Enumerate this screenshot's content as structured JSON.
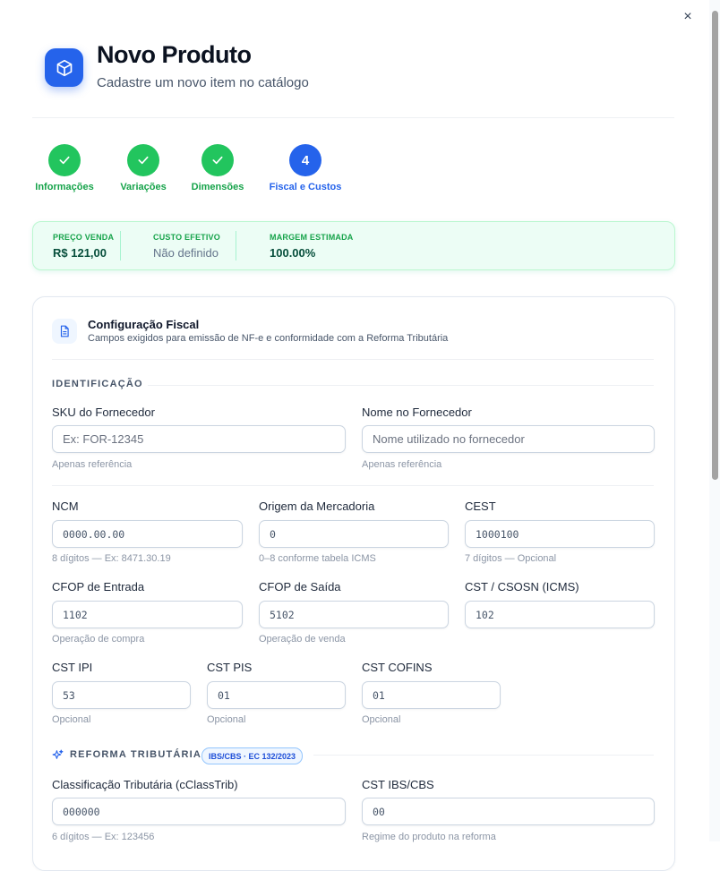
{
  "close_label": "×",
  "header": {
    "icon": "package-icon",
    "title": "Novo Produto",
    "subtitle": "Cadastre um novo item no catálogo"
  },
  "steps": [
    {
      "label": "Informações",
      "status": "done"
    },
    {
      "label": "Variações",
      "status": "done"
    },
    {
      "label": "Dimensões",
      "status": "done"
    },
    {
      "label": "Fiscal e Custos",
      "status": "active",
      "number": "4"
    }
  ],
  "summary": {
    "preco_label": "PREÇO VENDA",
    "preco_value": "R$ 121,00",
    "custo_label": "CUSTO EFETIVO",
    "custo_value": "Não definido",
    "margem_label": "MARGEM ESTIMADA",
    "margem_value": "100.00%"
  },
  "card": {
    "icon": "document-icon",
    "title": "Configuração Fiscal",
    "subtitle": "Campos exigidos para emissão de NF-e e conformidade com a Reforma Tributária"
  },
  "identificacao": {
    "heading": "IDENTIFICAÇÃO",
    "sku": {
      "label": "SKU do Fornecedor",
      "placeholder": "Ex: FOR-12345",
      "hint": "Apenas referência"
    },
    "nome": {
      "label": "Nome no Fornecedor",
      "placeholder": "Nome utilizado no fornecedor",
      "hint": "Apenas referência"
    }
  },
  "fiscal": {
    "ncm": {
      "label": "NCM",
      "placeholder": "0000.00.00",
      "hint": "8 dígitos — Ex: 8471.30.19"
    },
    "origem": {
      "label": "Origem da Mercadoria",
      "placeholder": "0",
      "hint": "0–8 conforme tabela ICMS"
    },
    "cest": {
      "label": "CEST",
      "placeholder": "1000100",
      "hint": "7 dígitos — Opcional"
    },
    "cfop_entrada": {
      "label": "CFOP de Entrada",
      "placeholder": "1102",
      "hint": "Operação de compra"
    },
    "cfop_saida": {
      "label": "CFOP de Saída",
      "placeholder": "5102",
      "hint": "Operação de venda"
    },
    "cst_icms": {
      "label": "CST / CSOSN (ICMS)",
      "placeholder": "102",
      "hint": ""
    },
    "cst_ipi": {
      "label": "CST IPI",
      "placeholder": "53",
      "hint": "Opcional"
    },
    "cst_pis": {
      "label": "CST PIS",
      "placeholder": "01",
      "hint": "Opcional"
    },
    "cst_cofins": {
      "label": "CST COFINS",
      "placeholder": "01",
      "hint": "Opcional"
    }
  },
  "reforma": {
    "icon": "sparkle-icon",
    "heading": "REFORMA TRIBUTÁRIA",
    "badge": "IBS/CBS · EC 132/2023",
    "cclass": {
      "label": "Classificação Tributária (cClassTrib)",
      "placeholder": "000000",
      "hint": "6 dígitos — Ex: 123456"
    },
    "cst_ibs": {
      "label": "CST IBS/CBS",
      "placeholder": "00",
      "hint": "Regime do produto na reforma"
    }
  }
}
